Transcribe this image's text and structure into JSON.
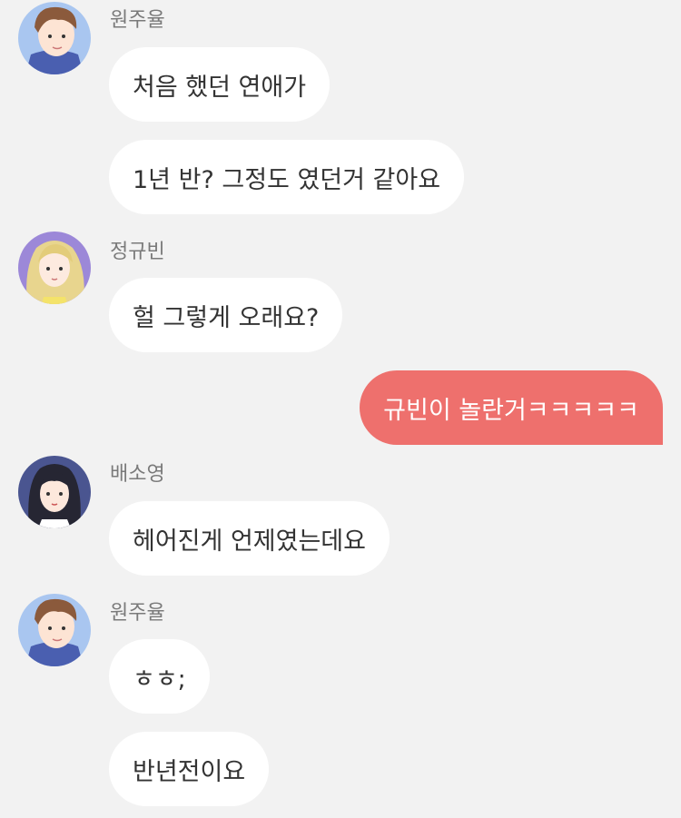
{
  "participants": {
    "wonjuyul": "원주율",
    "jeonggyubin": "정규빈",
    "baesoyoung": "배소영"
  },
  "colors": {
    "background": "#f2f2f2",
    "incoming_bubble": "#ffffff",
    "outgoing_bubble": "#ee706d",
    "sender_name": "#7a7a7a",
    "message_text": "#333333"
  },
  "messages": [
    {
      "sender": "원주율",
      "text": "처음 했던 연애가"
    },
    {
      "sender": "원주율",
      "text": "1년 반? 그정도 였던거 같아요"
    },
    {
      "sender": "정규빈",
      "text": "헐 그렇게 오래요?"
    },
    {
      "sender": "me",
      "text": "규빈이 놀란거ㅋㅋㅋㅋㅋ"
    },
    {
      "sender": "배소영",
      "text": "헤어진게 언제였는데요"
    },
    {
      "sender": "원주율",
      "text": "ㅎㅎ;"
    },
    {
      "sender": "원주율",
      "text": "반년전이요"
    }
  ]
}
